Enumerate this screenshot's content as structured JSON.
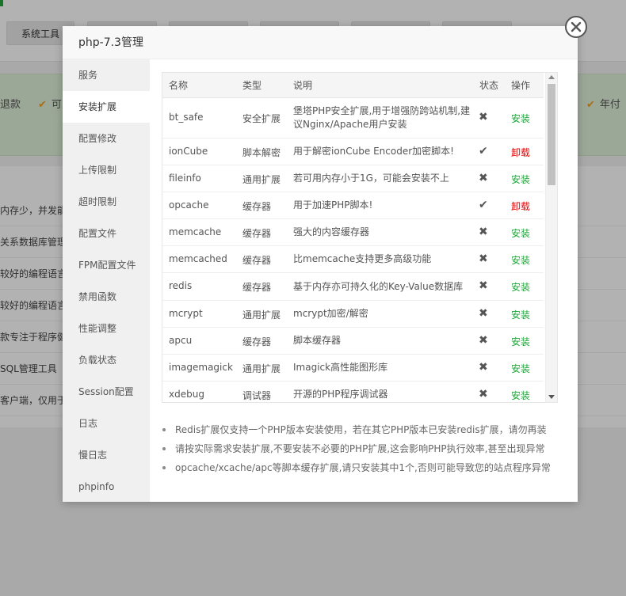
{
  "background": {
    "tool_tab": "系统工具",
    "green_left": "退款",
    "green_mid": "可",
    "green_right": "年付",
    "rows": [
      "内存少，并发能力",
      "关系数据库管理",
      "较好的编程语言",
      "较好的编程语言",
      "款专注于程序健",
      "SQL管理工具",
      "客户端，仅用于"
    ]
  },
  "modal": {
    "title": "php-7.3管理",
    "close": "×"
  },
  "sidebar": {
    "items": [
      {
        "label": "服务",
        "active": false
      },
      {
        "label": "安装扩展",
        "active": true
      },
      {
        "label": "配置修改",
        "active": false
      },
      {
        "label": "上传限制",
        "active": false
      },
      {
        "label": "超时限制",
        "active": false
      },
      {
        "label": "配置文件",
        "active": false
      },
      {
        "label": "FPM配置文件",
        "active": false
      },
      {
        "label": "禁用函数",
        "active": false
      },
      {
        "label": "性能调整",
        "active": false
      },
      {
        "label": "负载状态",
        "active": false
      },
      {
        "label": "Session配置",
        "active": false
      },
      {
        "label": "日志",
        "active": false
      },
      {
        "label": "慢日志",
        "active": false
      },
      {
        "label": "phpinfo",
        "active": false
      }
    ]
  },
  "table": {
    "headers": {
      "name": "名称",
      "type": "类型",
      "desc": "说明",
      "status": "状态",
      "op": "操作"
    },
    "rows": [
      {
        "name": "bt_safe",
        "type": "安全扩展",
        "desc": "堡塔PHP安全扩展,用于增强防跨站机制,建议Nginx/Apache用户安装",
        "installed": false,
        "op": "安装"
      },
      {
        "name": "ionCube",
        "type": "脚本解密",
        "desc": "用于解密ionCube Encoder加密脚本!",
        "installed": true,
        "op": "卸载"
      },
      {
        "name": "fileinfo",
        "type": "通用扩展",
        "desc": "若可用内存小于1G，可能会安装不上",
        "installed": false,
        "op": "安装"
      },
      {
        "name": "opcache",
        "type": "缓存器",
        "desc": "用于加速PHP脚本!",
        "installed": true,
        "op": "卸载"
      },
      {
        "name": "memcache",
        "type": "缓存器",
        "desc": "强大的内容缓存器",
        "installed": false,
        "op": "安装"
      },
      {
        "name": "memcached",
        "type": "缓存器",
        "desc": "比memcache支持更多高级功能",
        "installed": false,
        "op": "安装"
      },
      {
        "name": "redis",
        "type": "缓存器",
        "desc": "基于内存亦可持久化的Key-Value数据库",
        "installed": false,
        "op": "安装"
      },
      {
        "name": "mcrypt",
        "type": "通用扩展",
        "desc": "mcrypt加密/解密",
        "installed": false,
        "op": "安装"
      },
      {
        "name": "apcu",
        "type": "缓存器",
        "desc": "脚本缓存器",
        "installed": false,
        "op": "安装"
      },
      {
        "name": "imagemagick",
        "type": "通用扩展",
        "desc": "Imagick高性能图形库",
        "installed": false,
        "op": "安装"
      },
      {
        "name": "xdebug",
        "type": "调试器",
        "desc": "开源的PHP程序调试器",
        "installed": false,
        "op": "安装"
      }
    ],
    "status_icons": {
      "installed": "✔",
      "not_installed": "✖"
    }
  },
  "notes": [
    "Redis扩展仅支持一个PHP版本安装使用，若在其它PHP版本已安装redis扩展，请勿再装",
    "请按实际需求安装扩展,不要安装不必要的PHP扩展,这会影响PHP执行效率,甚至出现异常",
    "opcache/xcache/apc等脚本缓存扩展,请只安装其中1个,否则可能导致您的站点程序异常"
  ],
  "colors": {
    "install": "#20a53a",
    "uninstall": "#e00000",
    "brand_green": "#20a53a"
  }
}
